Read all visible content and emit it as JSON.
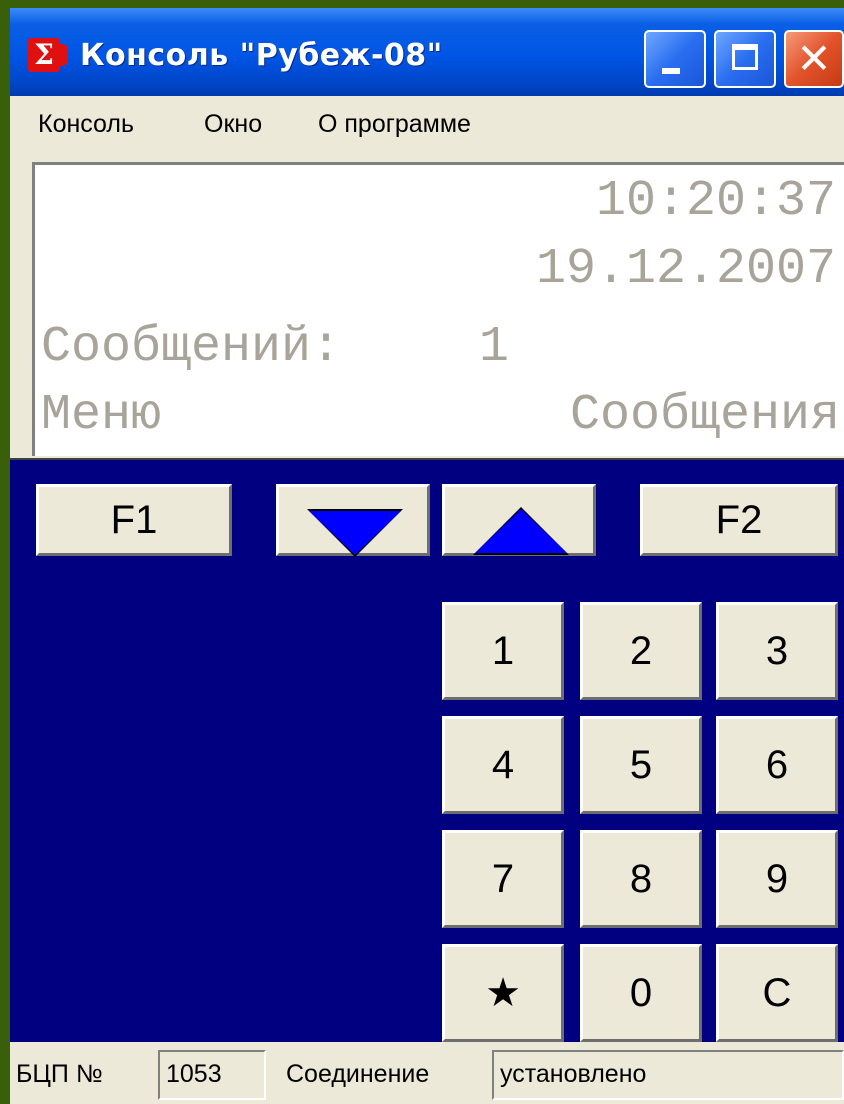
{
  "window": {
    "title": "Консоль \"Рубеж-08\"",
    "icon": "sigma-app-icon",
    "controls": [
      "minimize",
      "maximize",
      "close"
    ],
    "close_glyph": "✕"
  },
  "menu": {
    "items": [
      {
        "label": "Консоль"
      },
      {
        "label": "Окно"
      },
      {
        "label": "О программе"
      }
    ]
  },
  "display": {
    "time": "10:20:37",
    "date": "19.12.2007",
    "messages_label": "Сообщений:",
    "messages_count": "1",
    "softkey_left": "Меню",
    "softkey_right": "Сообщения",
    "text_color": "#a8a49a"
  },
  "keypad": {
    "f1": "F1",
    "f2": "F2",
    "down_icon": "arrow-down-icon",
    "up_icon": "arrow-up-icon",
    "digits": [
      "1",
      "2",
      "3",
      "4",
      "5",
      "6",
      "7",
      "8",
      "9",
      "★",
      "0",
      "C"
    ],
    "background": "#000080",
    "arrow_color": "#0000ff"
  },
  "status": {
    "bcp_label": "БЦП №",
    "bcp_value": "1053",
    "connection_label": "Соединение",
    "connection_value": "установлено"
  }
}
